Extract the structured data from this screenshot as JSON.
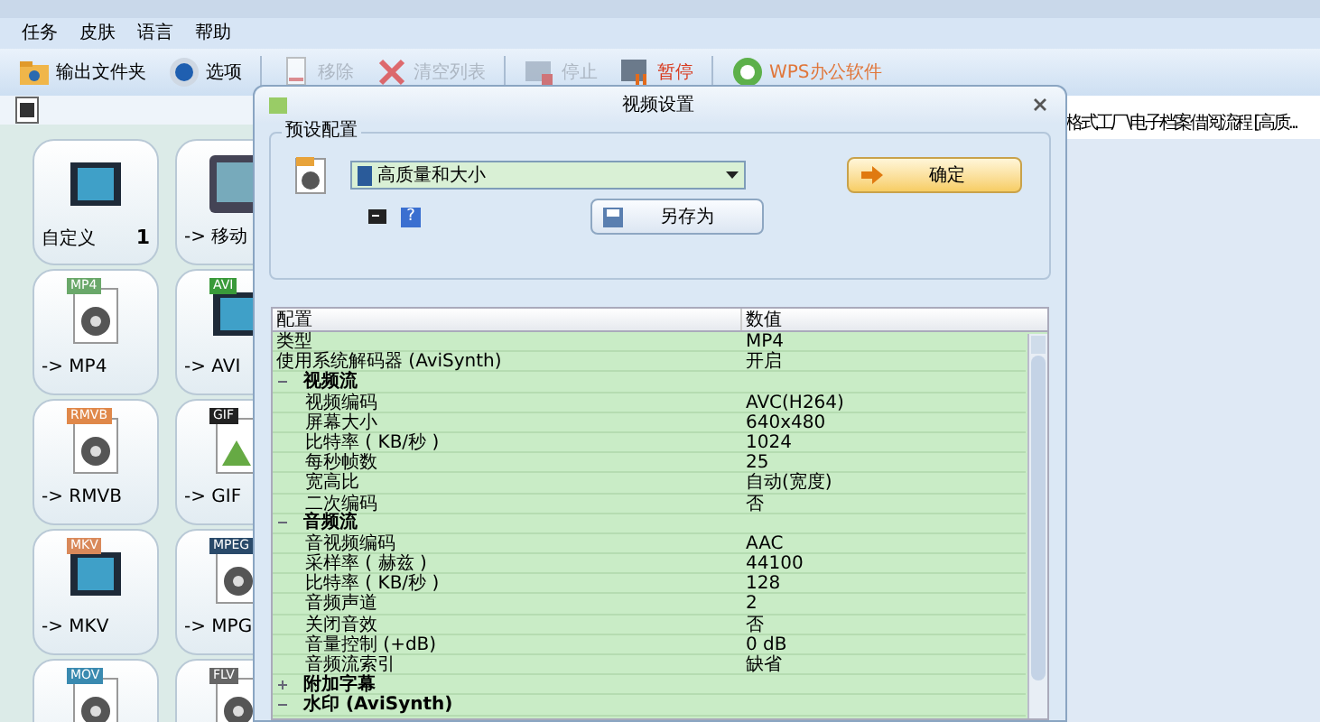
{
  "menu": [
    "任务",
    "皮肤",
    "语言",
    "帮助"
  ],
  "toolbar": [
    {
      "label": "输出文件夹",
      "disabled": false
    },
    {
      "label": "选项",
      "disabled": false
    },
    {
      "kind": "sep"
    },
    {
      "label": "移除",
      "disabled": true
    },
    {
      "label": "清空列表",
      "disabled": true
    },
    {
      "kind": "sep"
    },
    {
      "label": "停止",
      "disabled": true
    },
    {
      "label": "暂停",
      "disabled": false,
      "color": "#d83a1e"
    },
    {
      "kind": "sep"
    },
    {
      "label": "WPS办公软件",
      "disabled": false,
      "color": "#e0763a"
    }
  ],
  "file_path": "格式工厂\\电子档案借阅流程 [高质...",
  "tiles": [
    {
      "label": "自定义",
      "count": "1"
    },
    {
      "label": "-> 移动"
    },
    {
      "label": "-> MP4",
      "tag": "MP4"
    },
    {
      "label": "-> AVI",
      "tag": "AVI"
    },
    {
      "label": "-> RMVB",
      "tag": "RMVB"
    },
    {
      "label": "-> GIF",
      "tag": "GIF"
    },
    {
      "label": "-> MKV",
      "tag": "MKV"
    },
    {
      "label": "-> MPG",
      "tag": "MPEG"
    },
    {
      "tag": "MOV"
    },
    {
      "tag": "FLV"
    }
  ],
  "dialog": {
    "title": "视频设置",
    "group_title": "预设配置",
    "preset": "高质量和大小",
    "help": "?",
    "ok_button": "确定",
    "save_as_button": "另存为",
    "table": {
      "columns": [
        "配置",
        "数值"
      ],
      "rows": [
        {
          "kind": "row",
          "name": "类型",
          "value": "MP4"
        },
        {
          "kind": "row",
          "name": "使用系统解码器 (AviSynth)",
          "value": "开启"
        },
        {
          "kind": "group",
          "name": "视频流",
          "expanded": true,
          "children": [
            {
              "name": "视频编码",
              "value": "AVC(H264)"
            },
            {
              "name": "屏幕大小",
              "value": "640x480"
            },
            {
              "name": "比特率 ( KB/秒 )",
              "value": "1024"
            },
            {
              "name": "每秒帧数",
              "value": "25"
            },
            {
              "name": "宽高比",
              "value": "自动(宽度)"
            },
            {
              "name": "二次编码",
              "value": "否"
            }
          ]
        },
        {
          "kind": "group",
          "name": "音频流",
          "expanded": true,
          "children": [
            {
              "name": "音视频编码",
              "value": "AAC"
            },
            {
              "name": "采样率 ( 赫兹 )",
              "value": "44100"
            },
            {
              "name": "比特率 ( KB/秒 )",
              "value": "128"
            },
            {
              "name": "音频声道",
              "value": "2"
            },
            {
              "name": "关闭音效",
              "value": "否"
            },
            {
              "name": "音量控制 (+dB)",
              "value": "0 dB"
            },
            {
              "name": "音频流索引",
              "value": "缺省"
            }
          ]
        },
        {
          "kind": "group",
          "name": "附加字幕",
          "expanded": false
        },
        {
          "kind": "group",
          "name": "水印 (AviSynth)",
          "expanded": true
        }
      ]
    }
  }
}
